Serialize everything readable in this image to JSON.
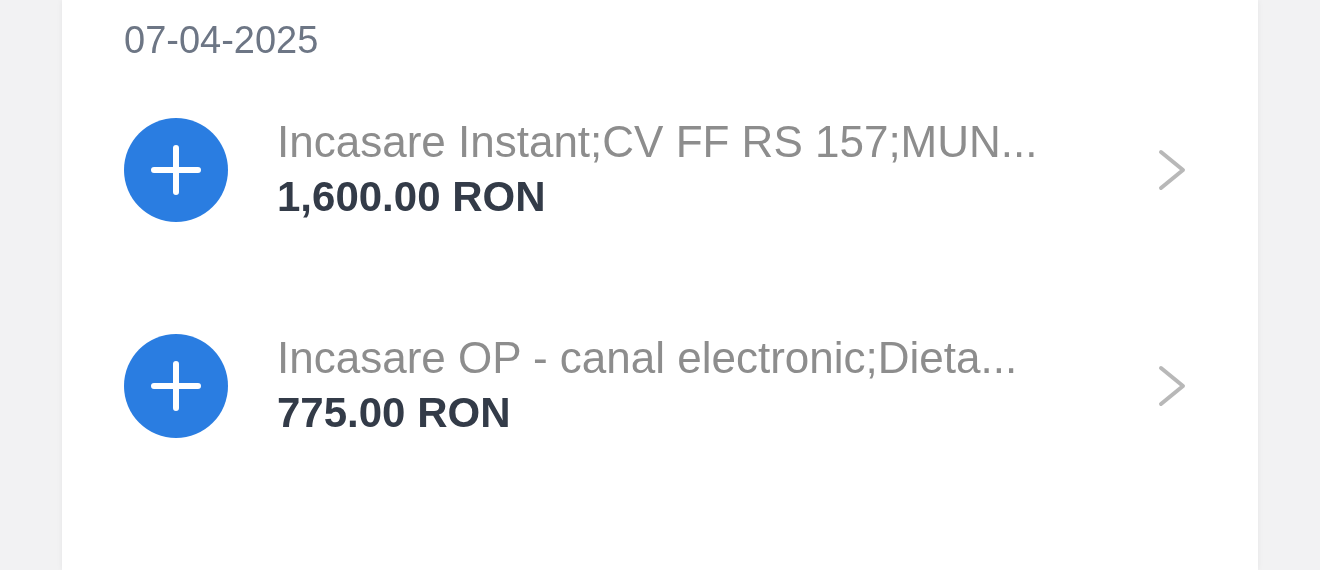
{
  "date": "07-04-2025",
  "transactions": [
    {
      "kind": "credit",
      "title": "Incasare Instant;CV FF RS 157;MUN...",
      "amount": "1,600.00 RON"
    },
    {
      "kind": "credit",
      "title": "Incasare OP - canal electronic;Dieta...",
      "amount": "775.00 RON"
    }
  ]
}
